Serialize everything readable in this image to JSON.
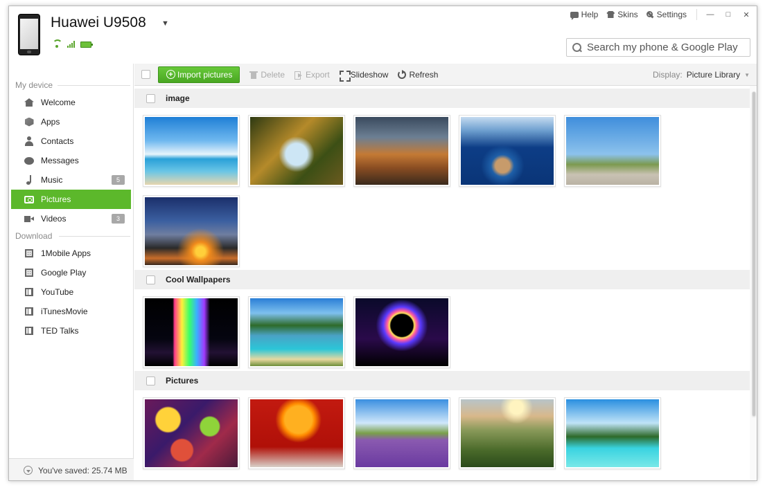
{
  "header": {
    "device_name": "Huawei U9508",
    "topbar": {
      "help": "Help",
      "skins": "Skins",
      "settings": "Settings"
    },
    "search": {
      "placeholder": "Search my phone & Google Play"
    }
  },
  "sidebar": {
    "my_device_label": "My device",
    "download_label": "Download",
    "device_items": [
      {
        "label": "Welcome",
        "icon": "home-icon"
      },
      {
        "label": "Apps",
        "icon": "apps-icon"
      },
      {
        "label": "Contacts",
        "icon": "contacts-icon"
      },
      {
        "label": "Messages",
        "icon": "messages-icon"
      },
      {
        "label": "Music",
        "icon": "music-icon",
        "badge": "5"
      },
      {
        "label": "Pictures",
        "icon": "pictures-icon",
        "active": true
      },
      {
        "label": "Videos",
        "icon": "videos-icon",
        "badge": "3"
      }
    ],
    "download_items": [
      {
        "label": "1Mobile Apps",
        "icon": "grid-icon"
      },
      {
        "label": "Google Play",
        "icon": "grid-icon"
      },
      {
        "label": "YouTube",
        "icon": "film-icon"
      },
      {
        "label": "iTunesMovie",
        "icon": "film-icon"
      },
      {
        "label": "TED Talks",
        "icon": "film-icon"
      }
    ],
    "saved_text": "You've saved: 25.74 MB"
  },
  "toolbar": {
    "import_label": "Import pictures",
    "delete_label": "Delete",
    "export_label": "Export",
    "slideshow_label": "Slideshow",
    "refresh_label": "Refresh",
    "display_label": "Display:",
    "display_value": "Picture Library"
  },
  "groups": [
    {
      "name": "image",
      "photos": [
        "linear-gradient(180deg,#1f7fd6 0%,#6fb8ef 35%,#e7f4fb 55%,#2aa0d8 62%,#69c5e6 80%,#e7d6ae 100%)",
        "radial-gradient(circle at 50% 55%,#cde6f5 0 18%,transparent 30%),linear-gradient(135deg,#2e3a12,#b58a2a 40%,#3c4f15 70%,#6b5a1f)",
        "linear-gradient(180deg,#3a4a5e 0%,#6c7f93 30%,#c47a35 55%,#8a4d22 75%,#3a2a1c 100%)",
        "radial-gradient(ellipse at 45% 72%,#c79b6b 0 10%,#1e5fa8 16%,transparent 30%),linear-gradient(180deg,#c4daf0 0%,#6e9fcf 20%,#0d3d86 45%,#0a3577 100%)",
        "linear-gradient(180deg,#3f8edc 0%,#8cc2ec 55%,#7c9a4f 70%,#c9c2b3 85%,#b9b2a4 100%)"
      ]
    },
    {
      "name": "",
      "photos": [
        "radial-gradient(circle at 60% 80%,#ffcf3a 0 6%,#f08a1c 12%,transparent 30%),linear-gradient(180deg,#1b2f6b 0%,#3b5fa0 35%,#6f7ea0 55%,#2a2a2a 75%,#c86d2a 90%,#3a2a20 100%)"
      ]
    },
    {
      "name": "Cool Wallpapers",
      "photos": [
        "linear-gradient(90deg,transparent 30%,#ff3a8a 32%,#ffef3a 40%,#3aff6a 48%,#3ab0ff 56%,#a03aff 64%,transparent 70%),linear-gradient(180deg,#000 0%,#050510 60%,#221133 80%,#000 100%)",
        "linear-gradient(180deg,#2a7fd6 0%,#7ec0ee 22%,#2e6b2a 40%,#4aa2c5 55%,#2bc6d8 75%,#e8d8a0 90%,#6e8f3a 100%)",
        "radial-gradient(circle at 50% 40%,#000 0 18%,#ffe25a 20%,#ff5aa0 24%,#5a3aff 30%,transparent 42%),linear-gradient(180deg,#0a0a2a 0%,#2a0a4a 60%,#000 100%)"
      ]
    },
    {
      "name": "Pictures",
      "photos": [
        "radial-gradient(circle at 25% 30%,#ffd23a 0 14%,transparent 16%),radial-gradient(circle at 70% 40%,#8fd43a 0 12%,transparent 14%),radial-gradient(circle at 40% 75%,#e0503a 0 14%,transparent 16%),linear-gradient(135deg,#6a1a5a,#3a1a6a 40%,#a02a4a 70%,#4a1a3a)",
        "radial-gradient(circle at 52% 30%,#ffb020 0 20%,#ff8a00 24%,transparent 34%),linear-gradient(180deg,#c21a10 0%,#b01008 70%,#d8d0c8 100%)",
        "linear-gradient(180deg,#3a8fe0 0%,#cfe7fa 35%,#7aa04a 50%,#8a5ab0 60%,#6a3aa0 100%)",
        "radial-gradient(circle at 60% 12%,#fff4c0 0 8%,transparent 20%),linear-gradient(180deg,#b8c4c8 0%,#d8b88a 25%,#8a9a5a 45%,#4a6a2a 75%,#2a4a1a 100%)",
        "linear-gradient(180deg,#2a8fe0 0%,#bfe3f7 35%,#2e6a2a 55%,#39d3e0 72%,#7ae8e8 100%)"
      ]
    }
  ]
}
